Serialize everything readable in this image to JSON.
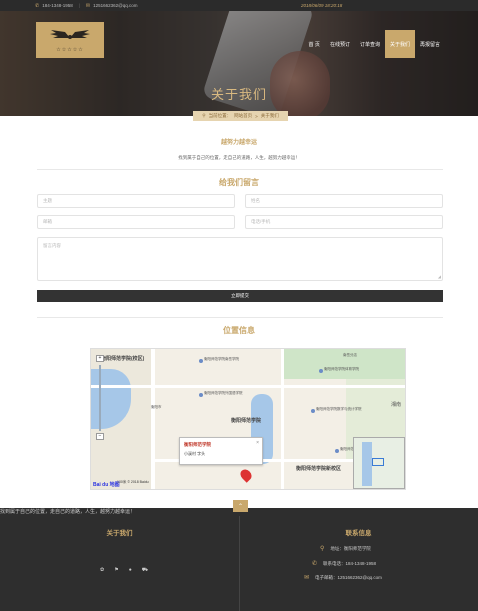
{
  "topbar": {
    "phone": "184-1348-1958",
    "email": "1251662362@qq.com",
    "date": "2018/06/09 18:20:18"
  },
  "brand": {
    "stars": "☆☆☆☆☆"
  },
  "nav": {
    "items": [
      "首 页",
      "在线预订",
      "订单查询",
      "关于我们",
      "再报留言"
    ],
    "active_index": 3
  },
  "hero": {
    "title": "关于我们"
  },
  "breadcrumb": {
    "current": "当前位置：",
    "home": "网站首页",
    "sep": ">",
    "page": "关于我们"
  },
  "about": {
    "heading": "越努力越幸运",
    "text": "找到属于自己的位置，走自己的道路，人生，越努力越幸运！"
  },
  "form": {
    "heading": "给我们留言",
    "fields": {
      "subject": "主题",
      "name": "姓名",
      "email": "邮箱",
      "phone": "电话/手机",
      "content": "留言内容"
    },
    "submit_label": "立即提交"
  },
  "location": {
    "heading": "位置信息",
    "map": {
      "popup_title": "衡阳师范学院",
      "popup_text": "小溪村 字头",
      "labels": [
        "衡阳师范学院",
        "衡阳师范学院南岳学院",
        "衡阳师范学院外国语学院",
        "衡阳师范学院体育学院",
        "衡阳师范学院数学与统计学院",
        "衡阳师范学院(校区)",
        "衡阳师范学院新校区",
        "衡阳市",
        "湘南",
        "衡阳师范学院附属中学",
        "南岳分店"
      ],
      "scale": "100米",
      "copyright": "© 2018 Baidu",
      "logo": "Bai du 地图"
    }
  },
  "footer": {
    "about": {
      "title": "关于我们",
      "text": "找到属于自己的位置，走自己的道路，人生，越努力越幸运！"
    },
    "contact": {
      "title": "联系信息",
      "address": "地址：衡阳师范学院",
      "phone": "联系电话：184-1348-1958",
      "email": "电子邮箱：1251662362@qq.com"
    }
  },
  "colors": {
    "accent": "#c9a86c",
    "dark": "#2e2e2e",
    "topbar": "#2b2b2b"
  }
}
